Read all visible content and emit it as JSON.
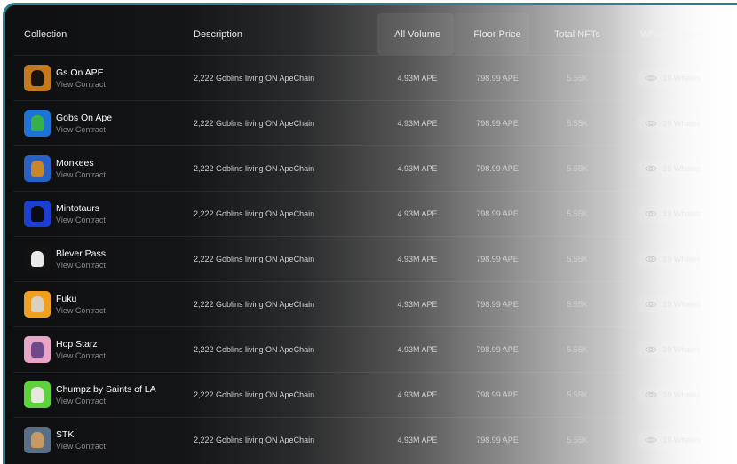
{
  "table": {
    "headers": {
      "collection": "Collection",
      "description": "Description",
      "all_volume": "All Volume",
      "floor_price": "Floor Price",
      "total_nfts": "Total NFTs",
      "whale_owners": "Whale Owners"
    },
    "rows": [
      {
        "name": "Gs On APE",
        "link": "View Contract",
        "description": "2,222 Goblins living ON ApeChain",
        "volume": "4.93M APE",
        "floor": "798.99 APE",
        "total": "5.55K",
        "whales": "19 Whales",
        "thumb": [
          "#c47a1c",
          "#1a1410"
        ]
      },
      {
        "name": "Gobs On Ape",
        "link": "View Contract",
        "description": "2,222 Goblins living ON ApeChain",
        "volume": "4.93M APE",
        "floor": "798.99 APE",
        "total": "5.55K",
        "whales": "19 Whales",
        "thumb": [
          "#1e73d6",
          "#36b04a"
        ]
      },
      {
        "name": "Monkees",
        "link": "View Contract",
        "description": "2,222 Goblins living ON ApeChain",
        "volume": "4.93M APE",
        "floor": "798.99 APE",
        "total": "5.55K",
        "whales": "19 Whales",
        "thumb": [
          "#2a5fc4",
          "#c9862b"
        ]
      },
      {
        "name": "Mintotaurs",
        "link": "View Contract",
        "description": "2,222 Goblins living ON ApeChain",
        "volume": "4.93M APE",
        "floor": "798.99 APE",
        "total": "5.55K",
        "whales": "19 Whales",
        "thumb": [
          "#1d3fd0",
          "#0b0b14"
        ]
      },
      {
        "name": "Blever Pass",
        "link": "View Contract",
        "description": "2,222 Goblins living ON ApeChain",
        "volume": "4.93M APE",
        "floor": "798.99 APE",
        "total": "5.55K",
        "whales": "19 Whales",
        "thumb": [
          "#121212",
          "#e8e8e8"
        ]
      },
      {
        "name": " Fuku",
        "link": "View Contract",
        "description": "2,222 Goblins living ON ApeChain",
        "volume": "4.93M APE",
        "floor": "798.99 APE",
        "total": "5.55K",
        "whales": "19 Whales",
        "thumb": [
          "#f0a020",
          "#d8d0c0"
        ]
      },
      {
        "name": "Hop Starz",
        "link": "View Contract",
        "description": "2,222 Goblins living ON ApeChain",
        "volume": "4.93M APE",
        "floor": "798.99 APE",
        "total": "5.55K",
        "whales": "19 Whales",
        "thumb": [
          "#e7a6c8",
          "#6e4a8a"
        ]
      },
      {
        "name": "Chumpz by Saints of LA",
        "link": "View Contract",
        "description": "2,222 Goblins living ON ApeChain",
        "volume": "4.93M APE",
        "floor": "798.99 APE",
        "total": "5.55K",
        "whales": "19 Whales",
        "thumb": [
          "#5fd13a",
          "#e8e8e0"
        ]
      },
      {
        "name": "STK",
        "link": "View Contract",
        "description": "2,222 Goblins living ON ApeChain",
        "volume": "4.93M APE",
        "floor": "798.99 APE",
        "total": "5.55K",
        "whales": "19 Whales",
        "thumb": [
          "#5a6e86",
          "#c89a62"
        ]
      }
    ]
  },
  "colors": {
    "border": "#2b7f93",
    "background": "#0d0e10"
  }
}
